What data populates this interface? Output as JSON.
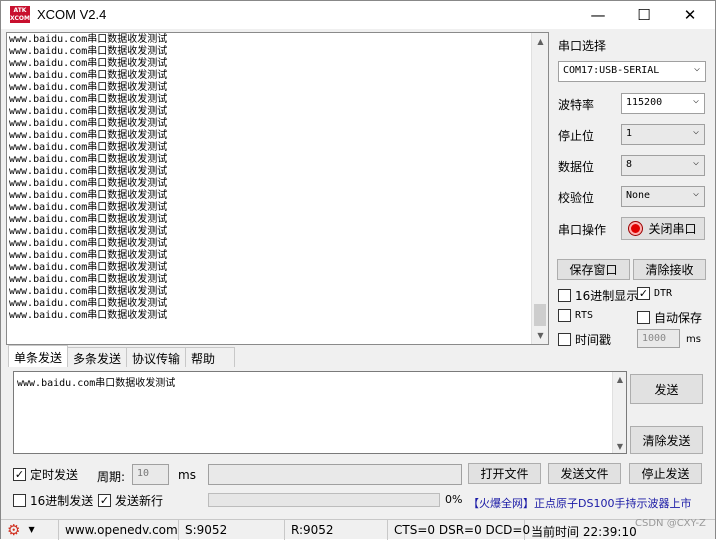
{
  "window": {
    "logo": "ATK XCOM",
    "title": "XCOM V2.4",
    "min": "—",
    "max": "☐",
    "close": "✕"
  },
  "receive": {
    "lines": [
      "www.baidu.com串口数据收发测试",
      "www.baidu.com串口数据收发测试",
      "www.baidu.com串口数据收发测试",
      "www.baidu.com串口数据收发测试",
      "www.baidu.com串口数据收发测试",
      "www.baidu.com串口数据收发测试",
      "www.baidu.com串口数据收发测试",
      "www.baidu.com串口数据收发测试",
      "www.baidu.com串口数据收发测试",
      "www.baidu.com串口数据收发测试",
      "www.baidu.com串口数据收发测试",
      "www.baidu.com串口数据收发测试",
      "www.baidu.com串口数据收发测试",
      "www.baidu.com串口数据收发测试",
      "www.baidu.com串口数据收发测试",
      "www.baidu.com串口数据收发测试",
      "www.baidu.com串口数据收发测试",
      "www.baidu.com串口数据收发测试",
      "www.baidu.com串口数据收发测试",
      "www.baidu.com串口数据收发测试",
      "www.baidu.com串口数据收发测试",
      "www.baidu.com串口数据收发测试",
      "www.baidu.com串口数据收发测试",
      "www.baidu.com串口数据收发测试"
    ]
  },
  "config": {
    "port_label": "串口选择",
    "port_value": "COM17:USB-SERIAL",
    "baud_label": "波特率",
    "baud_value": "115200",
    "stop_label": "停止位",
    "stop_value": "1",
    "data_label": "数据位",
    "data_value": "8",
    "parity_label": "校验位",
    "parity_value": "None",
    "op_label": "串口操作",
    "op_button": "关闭串口",
    "save_window": "保存窗口",
    "clear_receive": "清除接收",
    "hex_display": "16进制显示",
    "dtr": "DTR",
    "rts": "RTS",
    "auto_save": "自动保存",
    "timestamp": "时间戳",
    "timestamp_ms": "1000",
    "ms": "ms"
  },
  "tabs": [
    "单条发送",
    "多条发送",
    "协议传输",
    "帮助"
  ],
  "send": {
    "text": "www.baidu.com串口数据收发测试",
    "send_button": "发送",
    "clear_send": "清除发送",
    "timed_send": "定时发送",
    "period_label": "周期:",
    "period_value": "10",
    "period_unit": "ms",
    "open_file": "打开文件",
    "send_file": "发送文件",
    "stop_send": "停止发送",
    "hex_send": "16进制发送",
    "send_newline": "发送新行",
    "progress_pct": "0%",
    "progress": 0,
    "ad": "【火爆全网】正点原子DS100手持示波器上市"
  },
  "status": {
    "url": "www.openedv.com",
    "sent": "S:9052",
    "received": "R:9052",
    "lines": "CTS=0 DSR=0 DCD=0",
    "time": "当前时间 22:39:10",
    "watermark": "CSDN @CXY-Z"
  }
}
